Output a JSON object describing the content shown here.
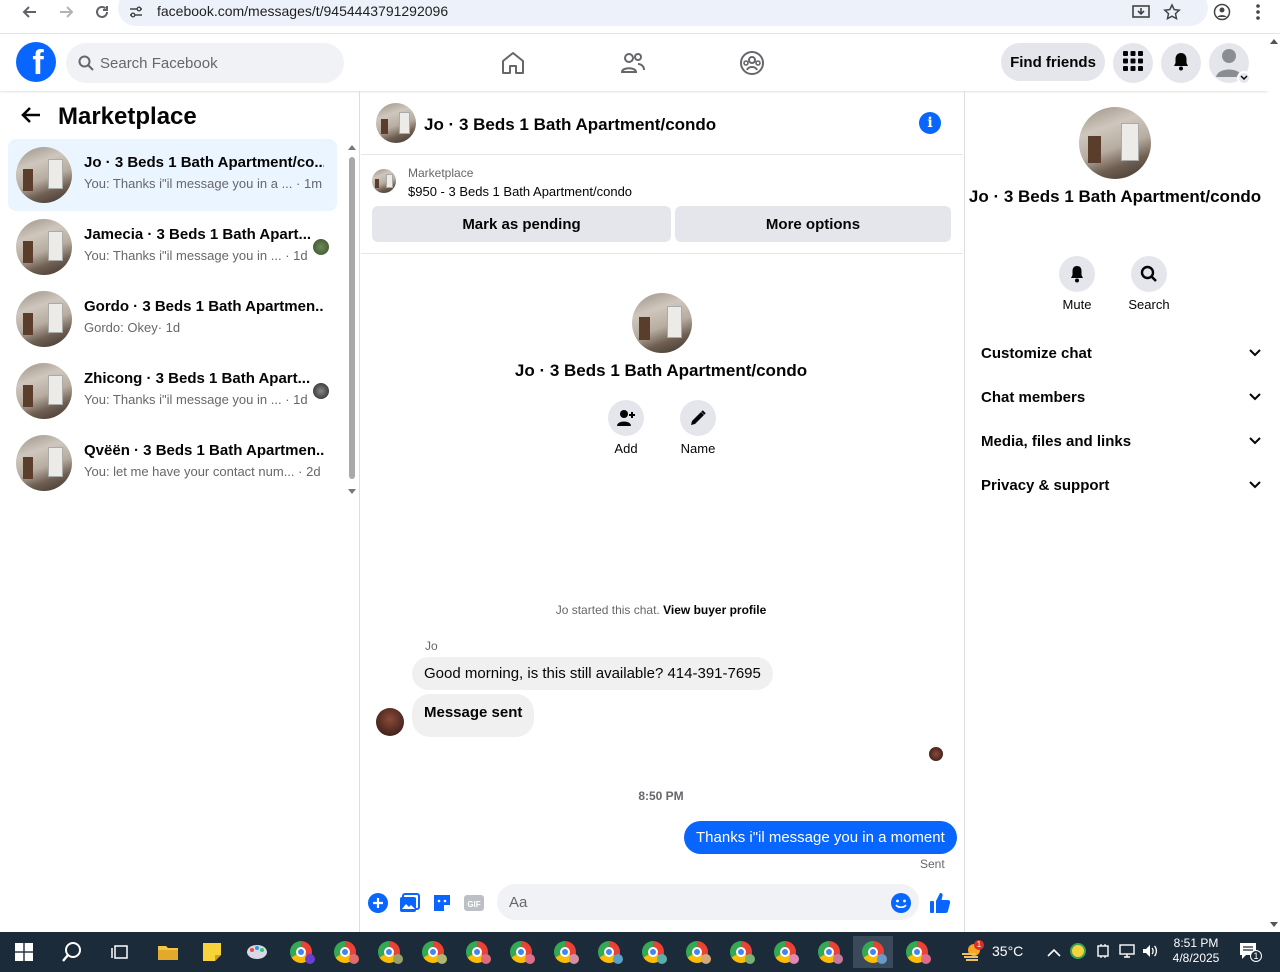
{
  "browser": {
    "url": "facebook.com/messages/t/9454443791292096"
  },
  "header": {
    "logo_letter": "f",
    "search_placeholder": "Search Facebook",
    "find_friends": "Find friends"
  },
  "sidebar": {
    "title": "Marketplace",
    "threads": [
      {
        "name": "Jo · 3 Beds 1 Bath Apartment/co...",
        "snippet": "You: Thanks i\"il message you in a ...",
        "time": "· 1m"
      },
      {
        "name": "Jamecia · 3 Beds 1 Bath Apart...",
        "snippet": "You: Thanks i\"il message you in ...",
        "time": "· 1d"
      },
      {
        "name": "Gordo · 3 Beds 1 Bath Apartmen...",
        "snippet": "Gordo: Okey",
        "time": "· 1d"
      },
      {
        "name": "Zhicong · 3 Beds 1 Bath Apart...",
        "snippet": "You: Thanks i\"il message you in ...",
        "time": "· 1d"
      },
      {
        "name": "Qvëën · 3 Beds 1 Bath Apartmen...",
        "snippet": "You: let me have your contact num...",
        "time": "· 2d"
      }
    ]
  },
  "chat": {
    "title": "Jo · 3 Beds 1 Bath Apartment/condo",
    "marketplace_label": "Marketplace",
    "listing": "$950 - 3 Beds 1 Bath Apartment/condo",
    "mark_pending": "Mark as pending",
    "more_options": "More options",
    "profile_name": "Jo · 3 Beds 1 Bath Apartment/condo",
    "add_label": "Add",
    "name_label": "Name",
    "system_msg": "Jo started this chat.",
    "view_buyer": "View buyer profile",
    "sender": "Jo",
    "msg1": "Good morning, is this still available? 414-391-7695",
    "msg2": "Message sent",
    "timestamp": "8:50 PM",
    "msg_out": "Thanks i\"il message you in a moment",
    "sent": "Sent",
    "composer_placeholder": "Aa"
  },
  "right_panel": {
    "name": "Jo · 3 Beds 1 Bath Apartment/condo",
    "mute": "Mute",
    "search": "Search",
    "sections": [
      "Customize chat",
      "Chat members",
      "Media, files and links",
      "Privacy & support"
    ]
  },
  "taskbar": {
    "temperature": "35°C",
    "time": "8:51 PM",
    "date": "4/8/2025",
    "weather_badge": "1",
    "notif_count": "1"
  },
  "colors": {
    "accent": "#0866ff",
    "active_thread": "#ebf5ff",
    "button_gray": "#e4e6eb"
  }
}
